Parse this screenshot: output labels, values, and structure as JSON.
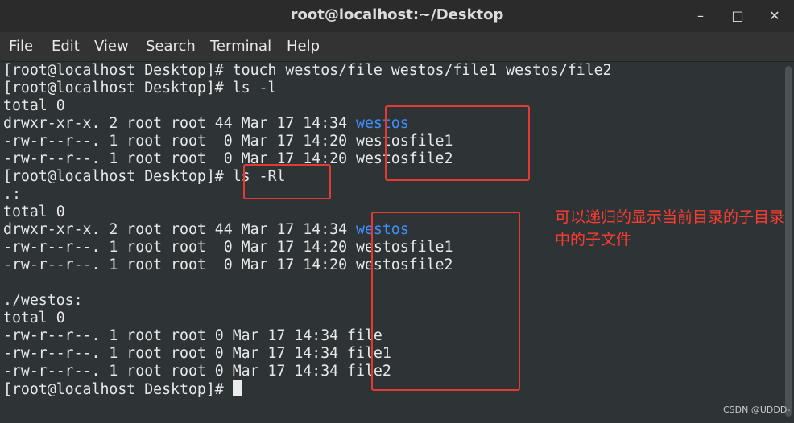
{
  "window": {
    "title": "root@localhost:~/Desktop",
    "minimize_label": "–",
    "maximize_label": "□",
    "close_label": "✕"
  },
  "menu": [
    "File",
    "Edit",
    "View",
    "Search",
    "Terminal",
    "Help"
  ],
  "terminal": {
    "lines": [
      "[root@localhost Desktop]# touch westos/file westos/file1 westos/file2",
      "[root@localhost Desktop]# ls -l",
      "total 0",
      "drwxr-xr-x. 2 root root 44 Mar 17 14:34 ",
      "-rw-r--r--. 1 root root  0 Mar 17 14:20 westosfile1",
      "-rw-r--r--. 1 root root  0 Mar 17 14:20 westosfile2",
      "[root@localhost Desktop]# ls -Rl",
      ".:",
      "total 0",
      "drwxr-xr-x. 2 root root 44 Mar 17 14:34 ",
      "-rw-r--r--. 1 root root  0 Mar 17 14:20 westosfile1",
      "-rw-r--r--. 1 root root  0 Mar 17 14:20 westosfile2",
      "",
      "./westos:",
      "total 0",
      "-rw-r--r--. 1 root root 0 Mar 17 14:34 file",
      "-rw-r--r--. 1 root root 0 Mar 17 14:34 file1",
      "-rw-r--r--. 1 root root 0 Mar 17 14:34 file2",
      "[root@localhost Desktop]# "
    ],
    "dir_name": "westos",
    "colors": {
      "background": "#2e3436",
      "text": "#e8e8e8",
      "directory": "#3f8fff"
    }
  },
  "annotation": {
    "text": "可以递归的显示当前目录的子目录中的子文件",
    "color": "#ff3b30"
  },
  "watermark": "CSDN @UDDD-"
}
